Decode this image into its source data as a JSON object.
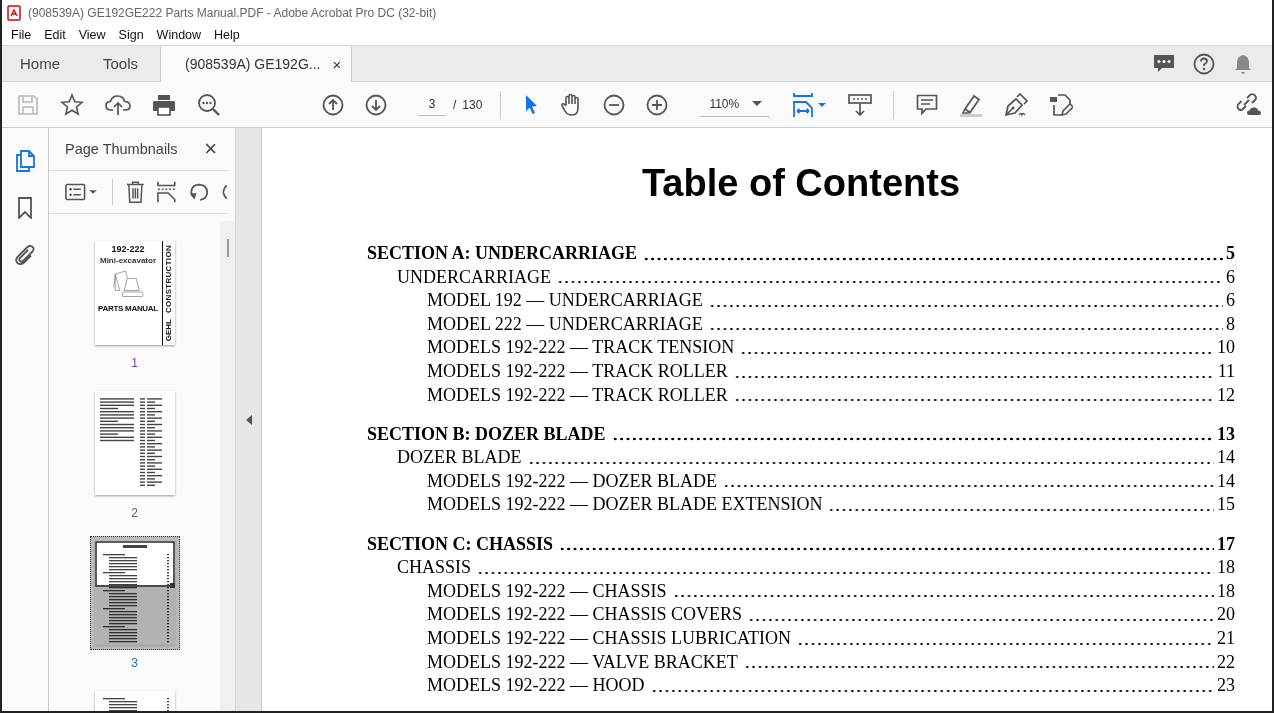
{
  "window": {
    "title": "(908539A) GE192GE222 Parts Manual.PDF - Adobe Acrobat Pro DC (32-bit)"
  },
  "menu": [
    "File",
    "Edit",
    "View",
    "Sign",
    "Window",
    "Help"
  ],
  "tabs": [
    {
      "label": "Home",
      "selected": false,
      "kind": "nav"
    },
    {
      "label": "Tools",
      "selected": false,
      "kind": "nav"
    },
    {
      "label": "(908539A) GE192G...",
      "selected": true,
      "kind": "document",
      "close": "×"
    }
  ],
  "toolbar": {
    "save_disabled": true,
    "page": "3",
    "page_separator": "/",
    "page_total": "130",
    "zoom": "110%",
    "tools": [
      {
        "kind": "select",
        "selected": true
      },
      {
        "kind": "hand",
        "selected": false
      }
    ]
  },
  "rail": [
    {
      "kind": "pages",
      "selected": true
    },
    {
      "kind": "bookmarks",
      "selected": false
    },
    {
      "kind": "attachments",
      "selected": false
    }
  ],
  "panel": {
    "title": "Page Thumbnails",
    "close": "×",
    "thumbnails": [
      {
        "kind": "cover",
        "label": "1",
        "selected": false,
        "title": "192-222",
        "subtitle": "Mini-excavator",
        "footer": "PARTS MANUAL",
        "brand": "GEHL",
        "tagline": "CONSTRUCTION"
      },
      {
        "kind": "text",
        "label": "2",
        "selected": false
      },
      {
        "kind": "contents",
        "label": "3",
        "selected": true
      },
      {
        "kind": "contents",
        "selected": false
      }
    ]
  },
  "document": {
    "title": "Table of Contents",
    "sections": [
      {
        "title": "SECTION A: UNDERCARRIAGE",
        "page": "5",
        "children": [
          {
            "title": "UNDERCARRIAGE",
            "page": "6",
            "children": [
              {
                "title": "MODEL 192 — UNDERCARRIAGE",
                "page": "6"
              },
              {
                "title": "MODEL 222 — UNDERCARRIAGE",
                "page": "8"
              },
              {
                "title": "MODELS 192-222 — TRACK TENSION",
                "page": "10"
              },
              {
                "title": "MODELS 192-222 — TRACK ROLLER",
                "page": "11"
              },
              {
                "title": "MODELS 192-222 — TRACK ROLLER",
                "page": "12"
              }
            ]
          }
        ]
      },
      {
        "title": "SECTION B: DOZER BLADE",
        "page": "13",
        "children": [
          {
            "title": "DOZER BLADE",
            "page": "14",
            "children": [
              {
                "title": "MODELS 192-222 — DOZER BLADE",
                "page": "14"
              },
              {
                "title": "MODELS 192-222 — DOZER BLADE EXTENSION",
                "page": "15"
              }
            ]
          }
        ]
      },
      {
        "title": "SECTION C: CHASSIS",
        "page": "17",
        "children": [
          {
            "title": "CHASSIS",
            "page": "18",
            "children": [
              {
                "title": "MODELS 192-222 — CHASSIS",
                "page": "18"
              },
              {
                "title": "MODELS 192-222 — CHASSIS COVERS",
                "page": "20"
              },
              {
                "title": "MODELS 192-222 — CHASSIS LUBRICATION",
                "page": "21"
              },
              {
                "title": "MODELS 192-222 — VALVE BRACKET",
                "page": "22"
              },
              {
                "title": "MODELS 192-222 — HOOD",
                "page": "23"
              }
            ]
          }
        ]
      }
    ]
  }
}
